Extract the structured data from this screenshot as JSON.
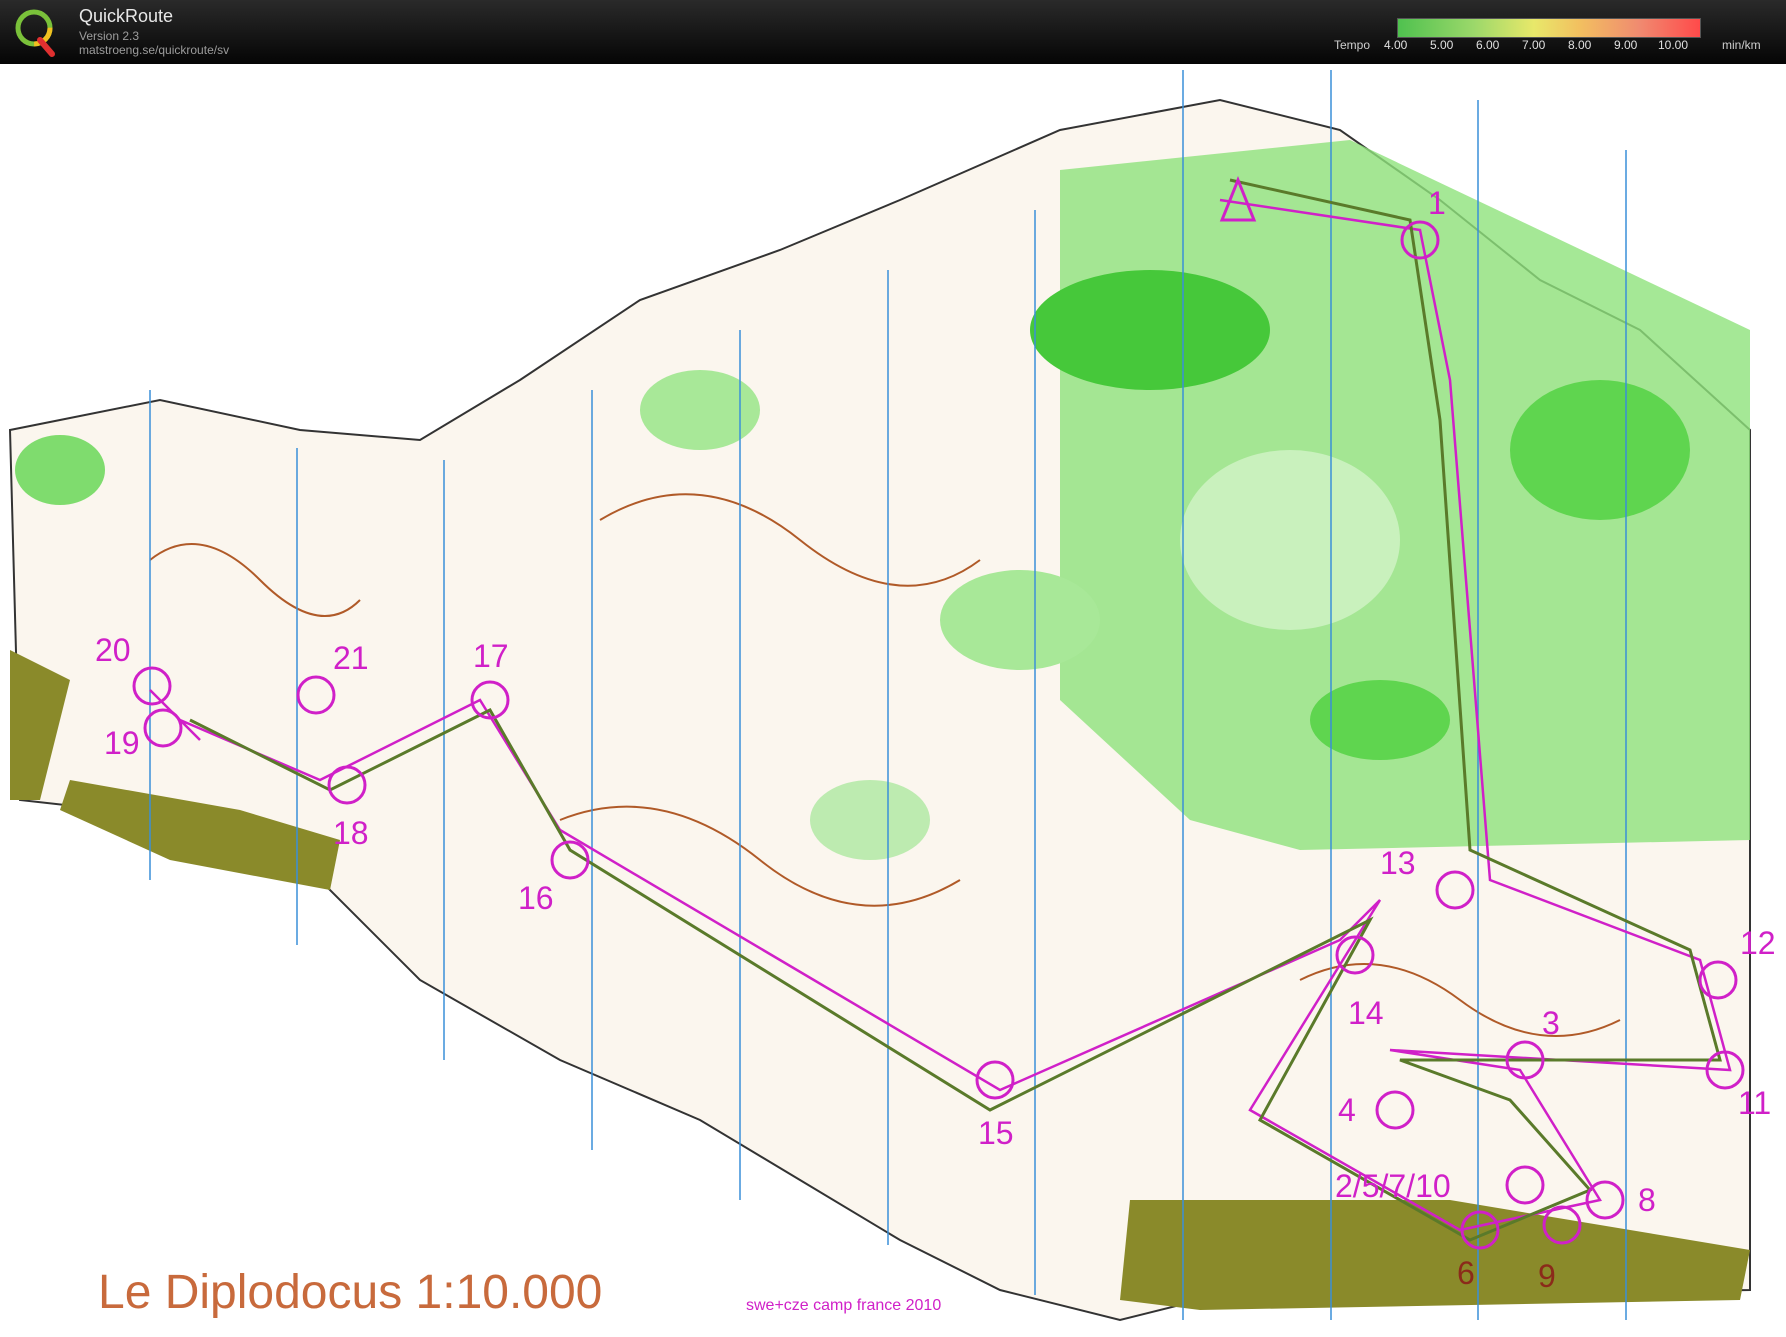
{
  "app": {
    "title": "QuickRoute",
    "version": "Version 2.3",
    "url": "matstroeng.se/quickroute/sv"
  },
  "legend": {
    "label": "Tempo",
    "ticks": [
      "4.00",
      "5.00",
      "6.00",
      "7.00",
      "8.00",
      "9.00",
      "10.00"
    ],
    "unit": "min/km",
    "colors": [
      "#4fc14f",
      "#9bd86a",
      "#e8e86a",
      "#f2c060",
      "#f08a70",
      "#ff4a4a"
    ]
  },
  "map": {
    "title": "Le Diplodocus 1:10.000",
    "subtitle": "swe+cze camp france 2010",
    "controls": [
      "1",
      "2/5/7/10",
      "3",
      "4",
      "6",
      "8",
      "9",
      "11",
      "12",
      "13",
      "14",
      "15",
      "16",
      "17",
      "18",
      "19",
      "20",
      "21"
    ]
  },
  "colors": {
    "header_bg": "#0c0c0c",
    "course": "#d020c8",
    "route": "#5a7a2a",
    "vegetation": "#57d24a",
    "urban": "#8a8a2a",
    "contour": "#b05a28"
  }
}
